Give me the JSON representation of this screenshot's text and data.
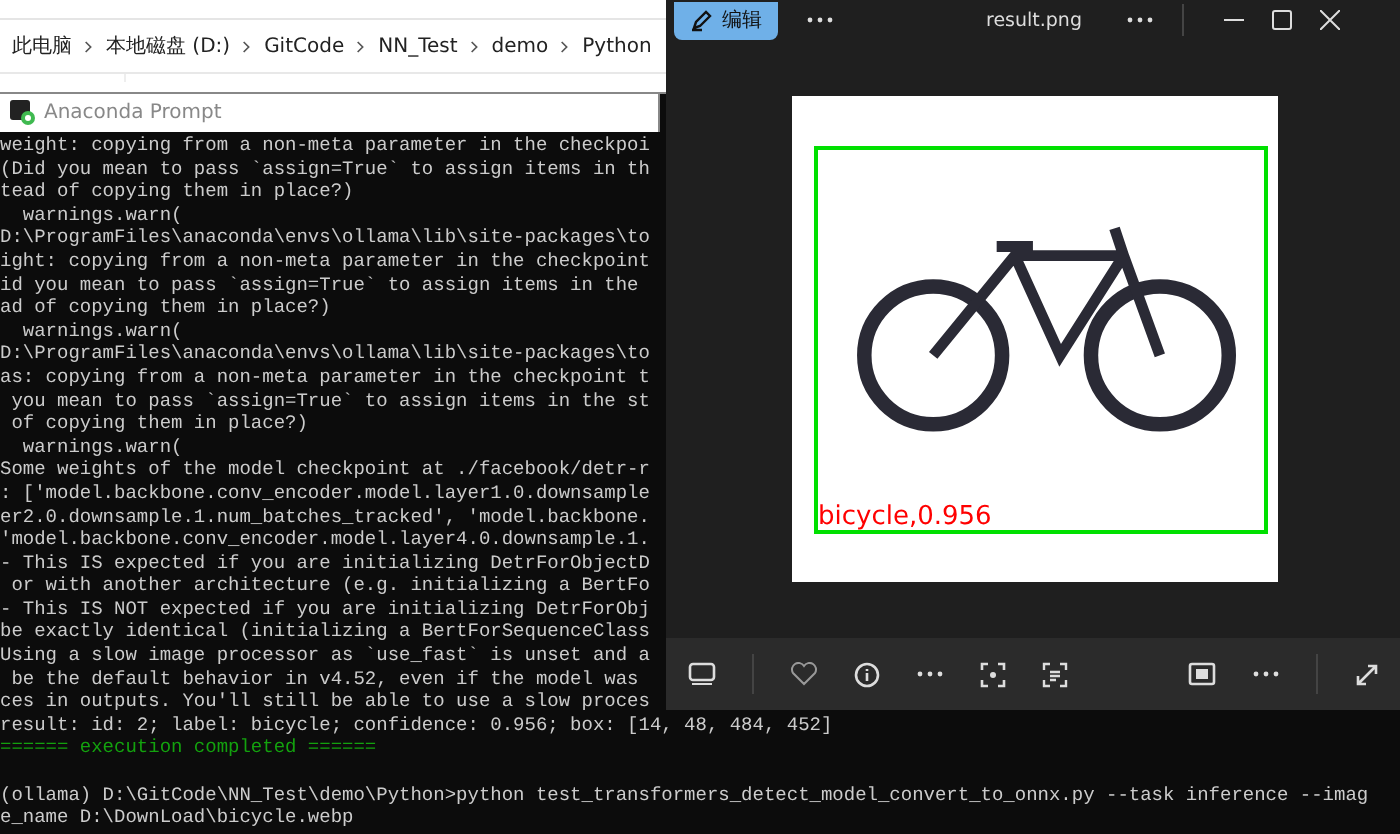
{
  "explorer": {
    "breadcrumb": [
      "此电脑",
      "本地磁盘 (D:)",
      "GitCode",
      "NN_Test",
      "demo",
      "Python"
    ]
  },
  "prompt": {
    "title": "Anaconda Prompt",
    "lines": [
      {
        "kind": "normal",
        "text": "weight: copying from a non-meta parameter in the checkpoi"
      },
      {
        "kind": "normal",
        "text": "(Did you mean to pass `assign=True` to assign items in th"
      },
      {
        "kind": "normal",
        "text": "tead of copying them in place?)"
      },
      {
        "kind": "normal",
        "text": "  warnings.warn("
      },
      {
        "kind": "normal",
        "text": "D:\\ProgramFiles\\anaconda\\envs\\ollama\\lib\\site-packages\\to"
      },
      {
        "kind": "normal",
        "text": "ight: copying from a non-meta parameter in the checkpoint"
      },
      {
        "kind": "normal",
        "text": "id you mean to pass `assign=True` to assign items in the"
      },
      {
        "kind": "normal",
        "text": "ad of copying them in place?)"
      },
      {
        "kind": "normal",
        "text": "  warnings.warn("
      },
      {
        "kind": "normal",
        "text": "D:\\ProgramFiles\\anaconda\\envs\\ollama\\lib\\site-packages\\to"
      },
      {
        "kind": "normal",
        "text": "as: copying from a non-meta parameter in the checkpoint t"
      },
      {
        "kind": "normal",
        "text": " you mean to pass `assign=True` to assign items in the st"
      },
      {
        "kind": "normal",
        "text": " of copying them in place?)"
      },
      {
        "kind": "normal",
        "text": "  warnings.warn("
      },
      {
        "kind": "normal",
        "text": "Some weights of the model checkpoint at ./facebook/detr-r"
      },
      {
        "kind": "normal",
        "text": ": ['model.backbone.conv_encoder.model.layer1.0.downsample"
      },
      {
        "kind": "normal",
        "text": "er2.0.downsample.1.num_batches_tracked', 'model.backbone."
      },
      {
        "kind": "normal",
        "text": "'model.backbone.conv_encoder.model.layer4.0.downsample.1."
      },
      {
        "kind": "normal",
        "text": "- This IS expected if you are initializing DetrForObjectD"
      },
      {
        "kind": "normal",
        "text": " or with another architecture (e.g. initializing a BertFo"
      },
      {
        "kind": "normal",
        "text": "- This IS NOT expected if you are initializing DetrForObj"
      },
      {
        "kind": "normal",
        "text": "be exactly identical (initializing a BertForSequenceClass"
      },
      {
        "kind": "normal",
        "text": "Using a slow image processor as `use_fast` is unset and a"
      },
      {
        "kind": "normal",
        "text": " be the default behavior in v4.52, even if the model was"
      },
      {
        "kind": "normal",
        "text": "ces in outputs. You'll still be able to use a slow proces"
      },
      {
        "kind": "normal",
        "text": "result: id: 2; label: bicycle; confidence: 0.956; box: [14, 48, 484, 452]"
      },
      {
        "kind": "success",
        "text": "====== execution completed ======"
      },
      {
        "kind": "blank"
      },
      {
        "kind": "normal",
        "text": "(ollama) D:\\GitCode\\NN_Test\\demo\\Python>python test_transformers_detect_model_convert_to_onnx.py --task inference --imag"
      },
      {
        "kind": "normal",
        "text": "e_name D:\\DownLoad\\bicycle.webp"
      }
    ]
  },
  "viewer": {
    "edit_button": "编辑",
    "title": "result.png",
    "detection_label": "bicycle,0.956",
    "favorite": false
  }
}
